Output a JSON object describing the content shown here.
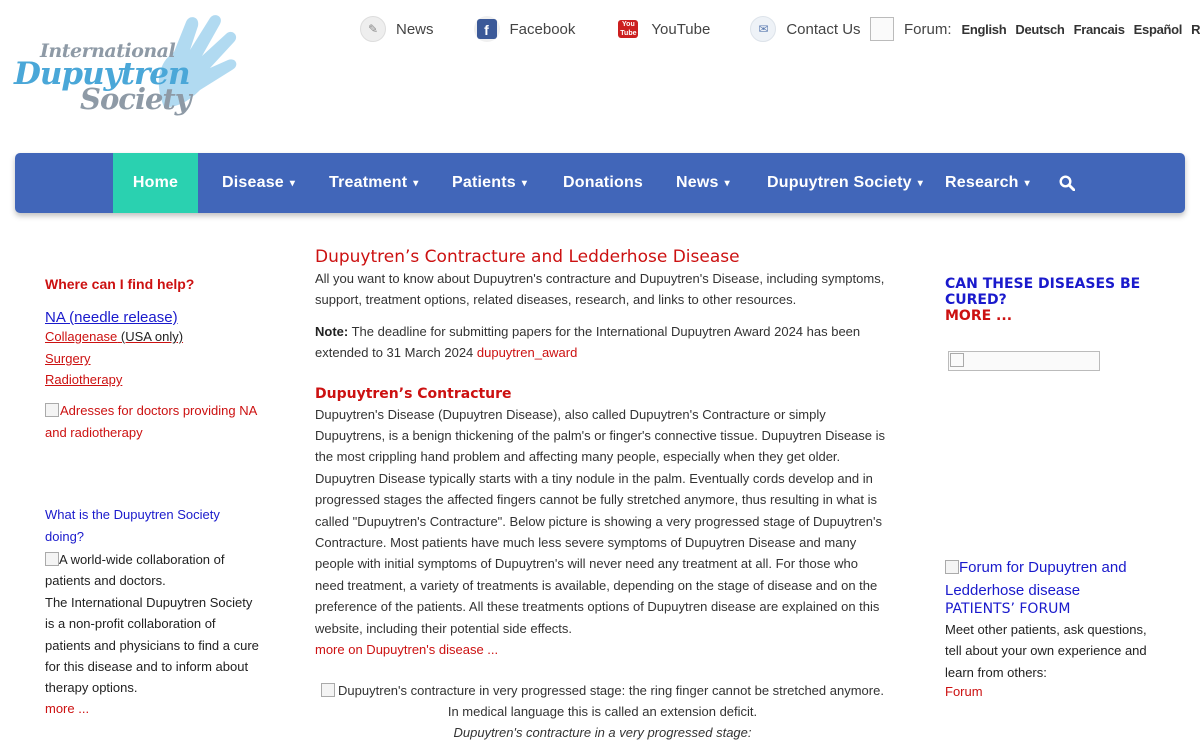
{
  "logo": {
    "line1": "International",
    "line2": "Dupuytren",
    "line3": "Society"
  },
  "top_links": [
    {
      "label": "News",
      "icon": "news-icon"
    },
    {
      "label": "Facebook",
      "icon": "facebook-icon"
    },
    {
      "label": "YouTube",
      "icon": "youtube-icon"
    },
    {
      "label": "Contact Us",
      "icon": "mail-icon"
    }
  ],
  "forum": {
    "label": "Forum:",
    "languages": [
      "English",
      "Deutsch",
      "Francais",
      "Español",
      "Russian"
    ]
  },
  "nav": {
    "items": [
      {
        "label": "Home",
        "active": true,
        "dropdown": false
      },
      {
        "label": "Disease",
        "dropdown": true
      },
      {
        "label": "Treatment",
        "dropdown": true
      },
      {
        "label": "Patients",
        "dropdown": true
      },
      {
        "label": "Donations",
        "dropdown": false
      },
      {
        "label": "News",
        "dropdown": true
      },
      {
        "label": "Dupuytren Society",
        "dropdown": true
      },
      {
        "label": "Research",
        "dropdown": true
      }
    ],
    "chevron": "⌄",
    "bg_color": "#4166b9",
    "active_color": "#2ad1b0"
  },
  "left": {
    "help_title": "Where can I find help?",
    "na_link": "NA (needle release)",
    "collagenase": "Collagenase",
    "usa_only": "(USA only)",
    "surgery": "Surgery",
    "radiotherapy": "Radiotherapy",
    "img_alt_1": "Adresses for doctors providing NA and radiotherapy",
    "what_title": "What is the Dupuytren Society doing?",
    "img_alt_2": "A world-wide collaboration of patients and doctors.",
    "society_text": "The International Dupuytren Society is a non-profit collaboration of patients and physicians to find a cure for this disease and to inform about therapy options.",
    "more": "more ..."
  },
  "main": {
    "title": "Dupuytren’s Contracture and Ledderhose Disease",
    "intro": "All you want to know about Dupuytren's contracture and Dupuytren's Disease, including symptoms, support, treatment options, related diseases, research, and links to other resources.",
    "note_label": "Note:",
    "note_text": " The deadline for submitting papers for the International Dupuytren Award 2024 has been extended to 31 March 2024 ",
    "note_link": "dupuytren_award",
    "section_title": "Dupuytren’s Contracture",
    "section_text": "Dupuytren's Disease (Dupuytren Disease), also called Dupuytren's Contracture or simply Dupuytrens, is a benign thickening of the palm's or finger's connective tissue. Dupuytren Disease is the most crippling hand problem and affecting many people, especially when they get older. Dupuytren Disease typically starts with a tiny nodule in the palm. Eventually cords develop and in progressed stages the affected fingers cannot be fully stretched anymore, thus resulting in what is called \"Dupuytren's Contracture\". Below picture is showing a very progressed stage of Dupuytren's Contracture. Most patients have much less severe symptoms of Dupuytren Disease and many people with initial symptoms of Dupuytren's will never need any treatment at all. For those who need treatment, a variety of treatments is available, depending on the stage of disease and on the preference of the patients. All these treatments options of Dupuytren disease are explained on this website, including their potential side effects.",
    "more_link": "more on Dupuytren's disease ...",
    "img_caption": "Dupuytren's contracture in very progressed stage: the ring finger cannot be stretched anymore. In medical language this is called an extension deficit.",
    "img_caption_italic": "Dupuytren's contracture in a very progressed stage:"
  },
  "right": {
    "cure_title": "CAN THESE DISEASES BE CURED?",
    "cure_more": "MORE ...",
    "forum_img_alt": "Forum for Dupuytren and Ledderhose disease",
    "forum_title": "PATIENTS’ FORUM",
    "forum_text": "Meet other patients, ask questions, tell about your own experience and learn from others:",
    "forum_link": "Forum"
  }
}
